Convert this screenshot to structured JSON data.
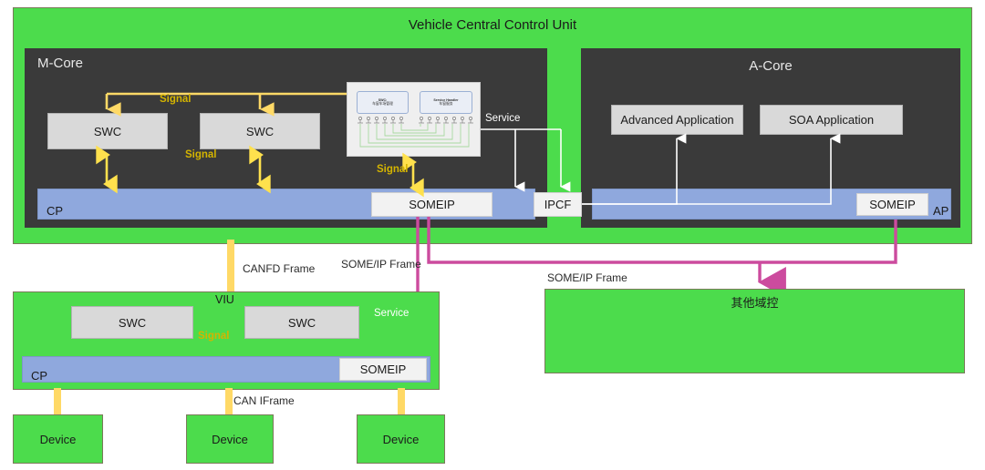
{
  "diagram": {
    "title": "Vehicle Central Control Unit"
  },
  "mcore": {
    "title": "M-Core",
    "swc1": "SWC",
    "swc2": "SWC",
    "bus_name": "CP",
    "someip": "SOMEIP",
    "signal_top": "Signal",
    "signal_mid": "Signal",
    "signal_low": "Signal",
    "service": "Service",
    "inset": {
      "swc_en": "SWC:",
      "swc_cn": "车窗车场管理",
      "handler_en": "Service Handler",
      "handler_cn": "车窗服务"
    }
  },
  "acore": {
    "title": "A-Core",
    "app1": "Advanced Application",
    "app2": "SOA Application",
    "bus_name": "AP",
    "someip": "SOMEIP"
  },
  "ipcf": {
    "label": "IPCF"
  },
  "links": {
    "canfd_frame": "CANFD Frame",
    "someip_frame_left": "SOME/IP Frame",
    "someip_frame_right": "SOME/IP Frame",
    "can_frame": "CAN IFrame"
  },
  "viu": {
    "title": "VIU",
    "swc1": "SWC",
    "swc2": "SWC",
    "bus_name": "CP",
    "someip": "SOMEIP",
    "signal": "Signal",
    "service": "Service"
  },
  "other_domain": {
    "label": "其他域控"
  },
  "devices": [
    {
      "label": "Device"
    },
    {
      "label": "Device"
    },
    {
      "label": "Device"
    }
  ],
  "colors": {
    "green": "#4cdc4c",
    "dark": "#3a3a3a",
    "bus_blue": "#8fa8dd",
    "signal_yellow": "#ffd966",
    "someip_magenta": "#cc4b9e",
    "module_grey": "#d9d9d9"
  }
}
